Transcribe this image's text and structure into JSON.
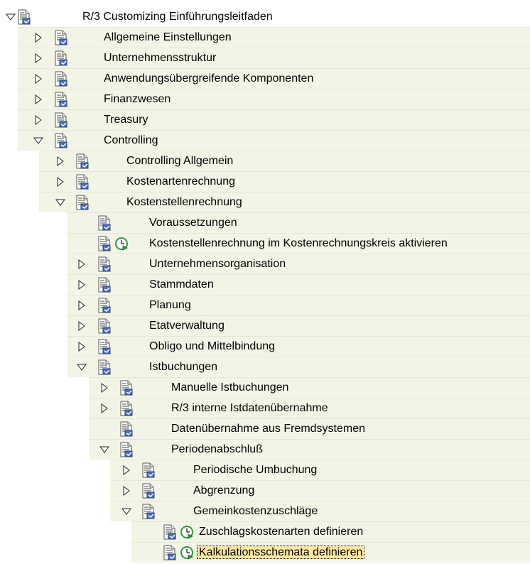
{
  "tree": {
    "nodes": [
      {
        "label": "R/3 Customizing Einführungsleitfaden",
        "toggle": "expanded",
        "clock": false,
        "selected": false
      },
      {
        "label": "Allgemeine Einstellungen",
        "toggle": "collapsed",
        "clock": false,
        "selected": false
      },
      {
        "label": "Unternehmensstruktur",
        "toggle": "collapsed",
        "clock": false,
        "selected": false
      },
      {
        "label": "Anwendungsübergreifende Komponenten",
        "toggle": "collapsed",
        "clock": false,
        "selected": false
      },
      {
        "label": "Finanzwesen",
        "toggle": "collapsed",
        "clock": false,
        "selected": false
      },
      {
        "label": "Treasury",
        "toggle": "collapsed",
        "clock": false,
        "selected": false
      },
      {
        "label": "Controlling",
        "toggle": "expanded",
        "clock": false,
        "selected": false
      },
      {
        "label": "Controlling Allgemein",
        "toggle": "collapsed",
        "clock": false,
        "selected": false
      },
      {
        "label": "Kostenartenrechnung",
        "toggle": "collapsed",
        "clock": false,
        "selected": false
      },
      {
        "label": "Kostenstellenrechnung",
        "toggle": "expanded",
        "clock": false,
        "selected": false
      },
      {
        "label": "Voraussetzungen",
        "toggle": "none",
        "clock": false,
        "selected": false
      },
      {
        "label": "Kostenstellenrechnung im Kostenrechnungskreis aktivieren",
        "toggle": "none",
        "clock": true,
        "selected": false
      },
      {
        "label": "Unternehmensorganisation",
        "toggle": "collapsed",
        "clock": false,
        "selected": false
      },
      {
        "label": "Stammdaten",
        "toggle": "collapsed",
        "clock": false,
        "selected": false
      },
      {
        "label": "Planung",
        "toggle": "collapsed",
        "clock": false,
        "selected": false
      },
      {
        "label": "Etatverwaltung",
        "toggle": "collapsed",
        "clock": false,
        "selected": false
      },
      {
        "label": "Obligo und Mittelbindung",
        "toggle": "collapsed",
        "clock": false,
        "selected": false
      },
      {
        "label": "Istbuchungen",
        "toggle": "expanded",
        "clock": false,
        "selected": false
      },
      {
        "label": "Manuelle Istbuchungen",
        "toggle": "collapsed",
        "clock": false,
        "selected": false
      },
      {
        "label": "R/3 interne Istdatenübernahme",
        "toggle": "collapsed",
        "clock": false,
        "selected": false
      },
      {
        "label": "Datenübernahme aus Fremdsystemen",
        "toggle": "none",
        "clock": false,
        "selected": false
      },
      {
        "label": "Periodenabschluß",
        "toggle": "expanded",
        "clock": false,
        "selected": false
      },
      {
        "label": "Periodische Umbuchung",
        "toggle": "collapsed",
        "clock": false,
        "selected": false
      },
      {
        "label": "Abgrenzung",
        "toggle": "collapsed",
        "clock": false,
        "selected": false
      },
      {
        "label": "Gemeinkostenzuschläge",
        "toggle": "expanded",
        "clock": false,
        "selected": false
      },
      {
        "label": "Zuschlagskostenarten definieren",
        "toggle": "none",
        "clock": true,
        "selected": false
      },
      {
        "label": "Kalkulationsschemata definieren",
        "toggle": "none",
        "clock": true,
        "selected": true
      }
    ]
  },
  "colors": {
    "band": "#f2f4e6",
    "selection": "#ffe7a3",
    "doc_blue": "#4a6fb5",
    "clock_green": "#2e9a3e"
  }
}
